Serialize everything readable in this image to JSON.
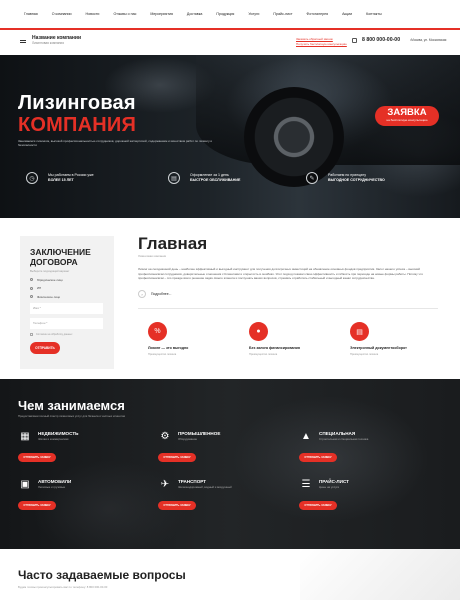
{
  "nav": {
    "items": [
      "Главная",
      "О компании",
      "Новости",
      "Отзывы о нас",
      "Мероприятия",
      "Доставка",
      "Продукция",
      "Услуги",
      "Прайс-лист",
      "Фотогалерея",
      "Акции",
      "Контакты"
    ]
  },
  "header": {
    "logo_title": "Название компании",
    "logo_subtitle": "Лизинговая компания",
    "link_call": "Заказать обратный звонок",
    "link_consult": "Получить бесплатную консультацию",
    "phone": "8 800 000-00-00",
    "city": "Москва, ул. Московская"
  },
  "hero": {
    "title_line1": "Лизинговая",
    "title_line2": "КОМПАНИЯ",
    "caption": "Занимаемся лизингом, высокой профессиональностью сотрудников, дорожной экспертизой, содержанием и качеством работ по лизингу и безопасности",
    "badge_title": "ЗАЯВКА",
    "badge_sub": "на бесплатную консультацию",
    "features": [
      {
        "icon": "clock-icon",
        "text": "Мы работаем в России уже",
        "bold": "БОЛЕЕ 15 ЛЕТ"
      },
      {
        "icon": "document-icon",
        "text": "Оформление за 1 день",
        "bold": "БЫСТРОЕ ОБСЛУЖИВАНИЕ"
      },
      {
        "icon": "handshake-icon",
        "text": "Работаем по принципу",
        "bold": "ВЫГОДНОЕ СОТРУДНИЧЕСТВО"
      }
    ]
  },
  "form": {
    "title": "ЗАКЛЮЧЕНИЕ ДОГОВОРА",
    "hint": "Выберите подходящий вариант",
    "options": [
      "Юридическое лицо",
      "ИП",
      "Физическое лицо"
    ],
    "name_placeholder": "Имя *",
    "phone_placeholder": "Телефон *",
    "agree": "Согласие на обработку данных",
    "submit": "ОТПРАВИТЬ"
  },
  "main": {
    "title": "Главная",
    "subtitle": "Лизинговая компания",
    "text": "Лизинг на сегодняшний день – наиболее эффективный и выгодный инструмент для получения долгосрочных инвестиций на обновление основных фондов предприятия. Залог нашего успеха – высокий профессионализм сотрудников, доверительные отношения с Клиентами и открытость в ошибках. Этот подход показал свою эффективность и гибкость при переходе на новые формы работы. Потому что профессионализм – это прежде всего решение задач своего клиента и послушать ваших вопросов, стремясь отработать стабильный и выгодный канал сотрудничества.",
    "more": "Подробнее...",
    "cards": [
      {
        "icon": "percent-icon",
        "title": "Лизинг — это выгодно",
        "sub": "Преимущество лизинга"
      },
      {
        "icon": "hand-coin-icon",
        "title": "Без залога финансирования",
        "sub": "Преимущество лизинга"
      },
      {
        "icon": "doc-flow-icon",
        "title": "Электронный документооборот",
        "sub": "Преимущество лизинга"
      }
    ]
  },
  "services": {
    "title": "Чем занимаемся",
    "subtitle": "Предоставляем полный спектр лизинговых услуг для бизнеса и частных клиентов",
    "items": [
      {
        "icon": "building-icon",
        "title": "НЕДВИЖИМОСТЬ",
        "sub": "Жилая и коммерческая",
        "button": "ОТПРАВИТЬ ЗАЯВКУ"
      },
      {
        "icon": "factory-icon",
        "title": "ПРОМЫШЛЕННОЕ",
        "sub": "Оборудование",
        "button": "ОТПРАВИТЬ ЗАЯВКУ"
      },
      {
        "icon": "crane-icon",
        "title": "СПЕЦИАЛЬНАЯ",
        "sub": "Строительная и специальная техника",
        "button": "ОТПРАВИТЬ ЗАЯВКУ"
      },
      {
        "icon": "car-icon",
        "title": "АВТОМОБИЛИ",
        "sub": "Легковые и грузовые",
        "button": "ОТПРАВИТЬ ЗАЯВКУ"
      },
      {
        "icon": "truck-icon",
        "title": "ТРАНСПОРТ",
        "sub": "Железнодорожный, водный и воздушный",
        "button": "ОТПРАВИТЬ ЗАЯВКУ"
      },
      {
        "icon": "price-list-icon",
        "title": "ПРАЙС-ЛИСТ",
        "sub": "Цены на услуги",
        "button": "ОТПРАВИТЬ ЗАЯВКУ"
      }
    ]
  },
  "faq": {
    "title": "Часто задаваемые вопросы",
    "subtitle": "Будем готовы проконсультировать вас по телефону: 8 800 000-00-00"
  },
  "colors": {
    "accent": "#e53026",
    "dark": "#1d2023",
    "text": "#222222"
  }
}
